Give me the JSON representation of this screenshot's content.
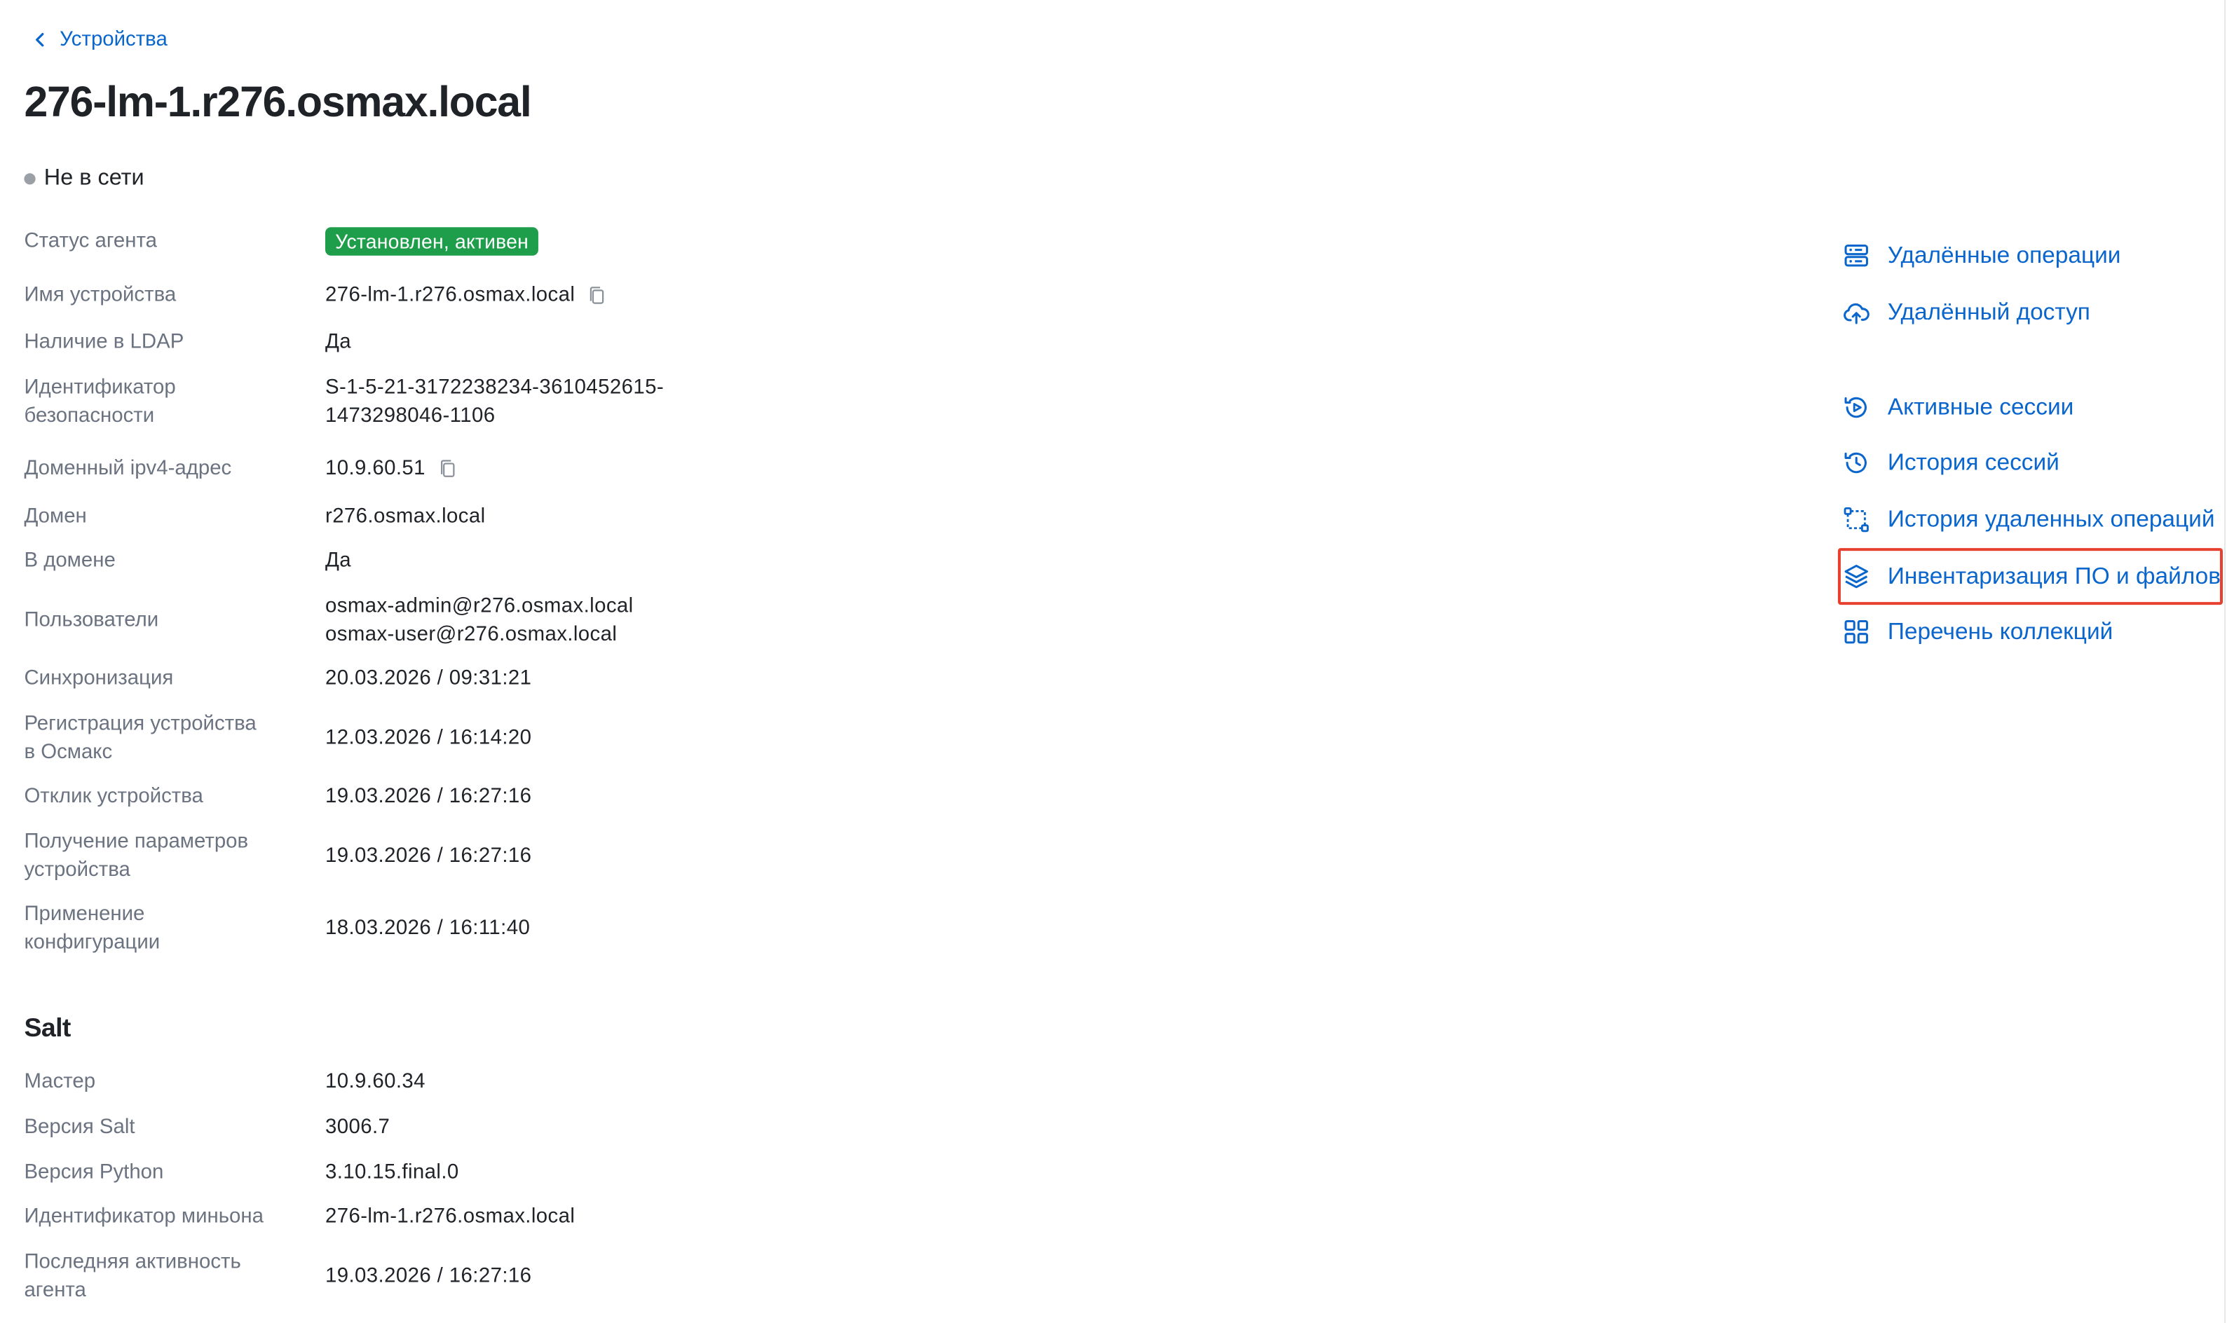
{
  "breadcrumb": {
    "label": "Устройства"
  },
  "device": {
    "title": "276-lm-1.r276.osmax.local",
    "status": "Не в сети"
  },
  "fields": {
    "agent_status": {
      "label": "Статус агента",
      "value": "Установлен, активен"
    },
    "device_name": {
      "label": "Имя устройства",
      "value": "276-lm-1.r276.osmax.local"
    },
    "ldap": {
      "label": "Наличие в LDAP",
      "value": "Да"
    },
    "sid": {
      "label_1": "Идентификатор",
      "label_2": "безопасности",
      "value_1": "S-1-5-21-3172238234-3610452615-",
      "value_2": "1473298046-1106"
    },
    "ipv4": {
      "label": "Доменный ipv4-адрес",
      "value": "10.9.60.51"
    },
    "domain": {
      "label": "Домен",
      "value": "r276.osmax.local"
    },
    "in_domain": {
      "label": "В домене",
      "value": "Да"
    },
    "users": {
      "label": "Пользователи",
      "value_1": "osmax-admin@r276.osmax.local",
      "value_2": "osmax-user@r276.osmax.local"
    },
    "sync": {
      "label": "Синхронизация",
      "value": "20.03.2026 / 09:31:21"
    },
    "registration": {
      "label_1": "Регистрация устройства",
      "label_2": "в Осмакс",
      "value": "12.03.2026 / 16:14:20"
    },
    "response": {
      "label": "Отклик устройства",
      "value": "19.03.2026 / 16:27:16"
    },
    "params": {
      "label_1": "Получение параметров",
      "label_2": "устройства",
      "value": "19.03.2026 / 16:27:16"
    },
    "config": {
      "label_1": "Применение",
      "label_2": "конфигурации",
      "value": "18.03.2026 / 16:11:40"
    }
  },
  "salt": {
    "title": "Salt",
    "master": {
      "label": "Мастер",
      "value": "10.9.60.34"
    },
    "salt_version": {
      "label": "Версия Salt",
      "value": "3006.7"
    },
    "python_version": {
      "label": "Версия Python",
      "value": "3.10.15.final.0"
    },
    "minion_id": {
      "label": "Идентификатор миньона",
      "value": "276-lm-1.r276.osmax.local"
    },
    "last_activity": {
      "label_1": "Последняя активность",
      "label_2": "агента",
      "value": "19.03.2026 / 16:27:16"
    }
  },
  "actions": {
    "remote_ops": {
      "label": "Удалённые операции",
      "icon": "server-icon"
    },
    "remote_access": {
      "label": "Удалённый доступ",
      "icon": "cloud-upload-icon"
    },
    "active_sessions": {
      "label": "Активные сессии",
      "icon": "play-circle-icon"
    },
    "session_history": {
      "label": "История сессий",
      "icon": "history-icon"
    },
    "remote_ops_history": {
      "label": "История удаленных операций",
      "icon": "workflow-icon"
    },
    "inventory": {
      "label": "Инвентаризация ПО и файлов",
      "icon": "layers-icon",
      "highlighted": true
    },
    "collections": {
      "label": "Перечень коллекций",
      "icon": "grid-icon"
    }
  },
  "colors": {
    "link": "#0a66cc",
    "badge_green": "#1e9e4a",
    "highlight_red": "#e8402e",
    "offline_dot": "#9aa0a6"
  }
}
